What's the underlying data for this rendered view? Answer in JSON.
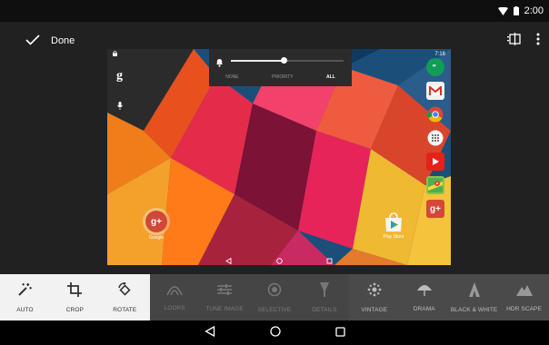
{
  "status_bar": {
    "time": "2:00",
    "icons": [
      "wifi-icon",
      "battery-icon"
    ]
  },
  "top_bar": {
    "done_label": "Done",
    "actions": [
      "compare-icon",
      "overflow-menu-icon"
    ]
  },
  "photo": {
    "tablet_status_time": "7:16",
    "google_letter": "g",
    "volume_panel": {
      "options": [
        "NONE",
        "PRIORITY",
        "ALL"
      ],
      "selected": "ALL",
      "level": 0.47
    },
    "dock_apps": [
      "Hangouts",
      "Gmail",
      "Chrome",
      "Apps",
      "YouTube",
      "Maps",
      "Google+"
    ],
    "home_apps": [
      {
        "name": "Google",
        "glyph": "g+"
      },
      {
        "name": "Play Store",
        "glyph": ""
      }
    ]
  },
  "tools": [
    {
      "label": "AUTO",
      "icon": "auto-wand-icon",
      "state": "active"
    },
    {
      "label": "CROP",
      "icon": "crop-icon",
      "state": "active"
    },
    {
      "label": "ROTATE",
      "icon": "rotate-icon",
      "state": "active"
    },
    {
      "label": "LOOKS",
      "icon": "looks-icon",
      "state": "dim"
    },
    {
      "label": "TUNE IMAGE",
      "icon": "tune-icon",
      "state": "dim"
    },
    {
      "label": "SELECTIVE",
      "icon": "selective-icon",
      "state": "dim"
    },
    {
      "label": "DETAILS",
      "icon": "details-icon",
      "state": "dim"
    },
    {
      "label": "VINTAGE",
      "icon": "vintage-icon",
      "state": "photo"
    },
    {
      "label": "DRAMA",
      "icon": "drama-icon",
      "state": "photo"
    },
    {
      "label": "BLACK & WHITE",
      "icon": "black-white-icon",
      "state": "photo"
    },
    {
      "label": "HDR SCAPE",
      "icon": "hdr-scape-icon",
      "state": "photo"
    }
  ],
  "nav_bar": [
    "back-icon",
    "home-icon",
    "recents-icon"
  ]
}
